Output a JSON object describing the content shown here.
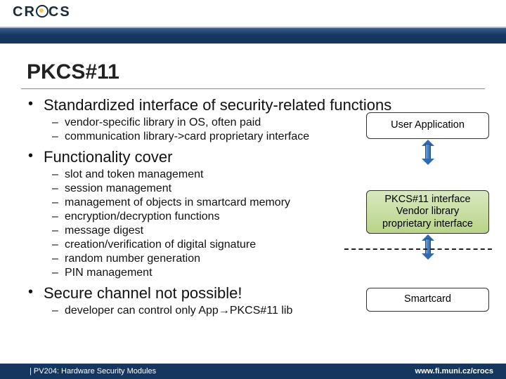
{
  "logo_text_pre": "CR",
  "logo_text_post": "CS",
  "title": "PKCS#11",
  "b1_0": "Standardized interface of security-related functions",
  "b1_0_sub": [
    "vendor-specific library in OS, often paid",
    "communication library->card proprietary interface"
  ],
  "b1_1": "Functionality cover",
  "b1_1_sub": [
    "slot and token management",
    "session management",
    "management of objects in smartcard memory",
    "encryption/decryption functions",
    "message digest",
    "creation/verification of digital signature",
    "random number generation",
    "PIN management"
  ],
  "b1_2": "Secure channel not possible!",
  "b1_2_sub": [
    "developer can control only App→PKCS#11 lib"
  ],
  "box1": "User Application",
  "box2_l1": "PKCS#11 interface",
  "box2_l2": "Vendor library",
  "box2_l3": "proprietary interface",
  "box3": "Smartcard",
  "footer_left": "| PV204: Hardware Security Modules",
  "footer_right": "www.fi.muni.cz/crocs"
}
